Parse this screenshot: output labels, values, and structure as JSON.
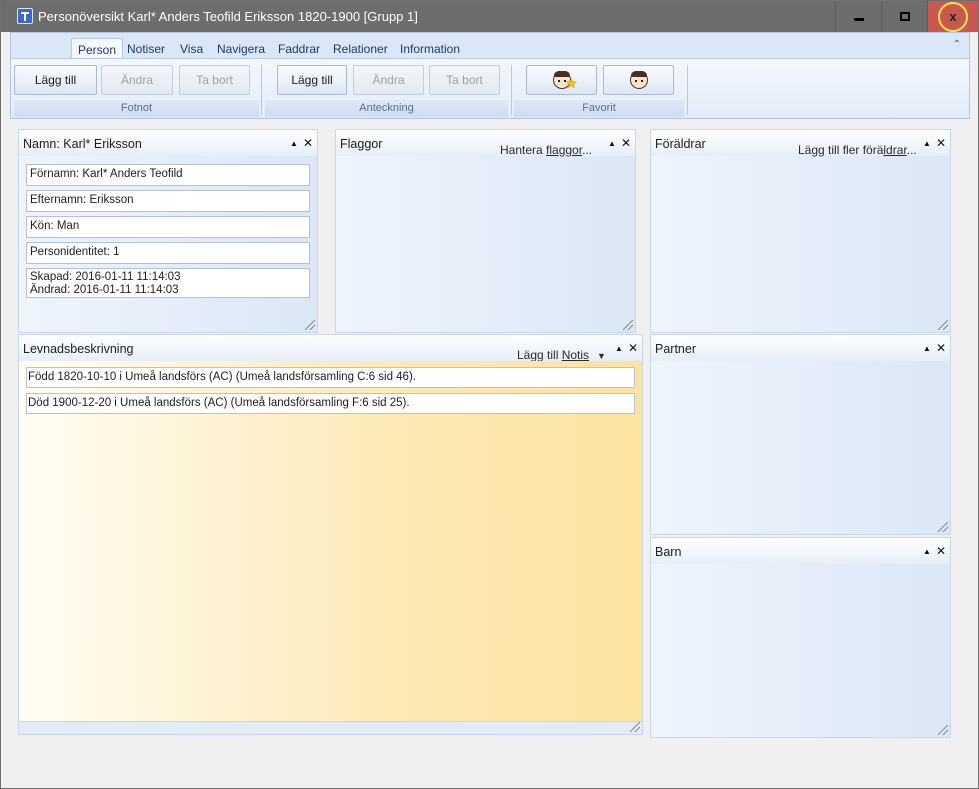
{
  "window": {
    "title": "Personöversikt Karl* Anders Teofild Eriksson 1820-1900 [Grupp 1]",
    "close_glyph": "x"
  },
  "ribbon": {
    "tabs": [
      "Person",
      "Notiser",
      "Visa",
      "Navigera",
      "Faddrar",
      "Relationer",
      "Information"
    ],
    "active_tab": "Person",
    "collapse_glyph": "⌃",
    "groups": {
      "fotnot": {
        "label": "Fotnot",
        "add": "Lägg till",
        "edit": "Ändra",
        "remove": "Ta bort"
      },
      "anteckning": {
        "label": "Anteckning",
        "add": "Lägg till",
        "edit": "Ändra",
        "remove": "Ta bort"
      },
      "favorit": {
        "label": "Favorit"
      }
    }
  },
  "panels": {
    "name": {
      "title": "Namn: Karl* Eriksson",
      "fields": {
        "fornamn": "Förnamn: Karl* Anders Teofild",
        "efternamn": "Efternamn: Eriksson",
        "kon": "Kön: Man",
        "personidentitet": "Personidentitet: 1",
        "skapad": "Skapad: 2016-01-11 11:14:03",
        "andrad": "Ändrad: 2016-01-11 11:14:03"
      }
    },
    "flaggor": {
      "title": "Flaggor",
      "action_prefix": "Hantera ",
      "action_underlined": "flaggor",
      "action_suffix": "..."
    },
    "foraldrar": {
      "title": "Föräldrar",
      "action_prefix": "Lägg till fler förä",
      "action_underlined": "ldrar",
      "action_suffix": "..."
    },
    "levnad": {
      "title": "Levnadsbeskrivning",
      "action_prefix": "Lägg till ",
      "action_underlined": "Notis",
      "events": [
        "Född 1820-10-10 i Umeå landsförs (AC) (Umeå landsförsamling C:6 sid  46).",
        "Död 1900-12-20 i Umeå landsförs (AC) (Umeå landsförsamling F:6 sid  25)."
      ]
    },
    "partner": {
      "title": "Partner"
    },
    "barn": {
      "title": "Barn"
    }
  }
}
